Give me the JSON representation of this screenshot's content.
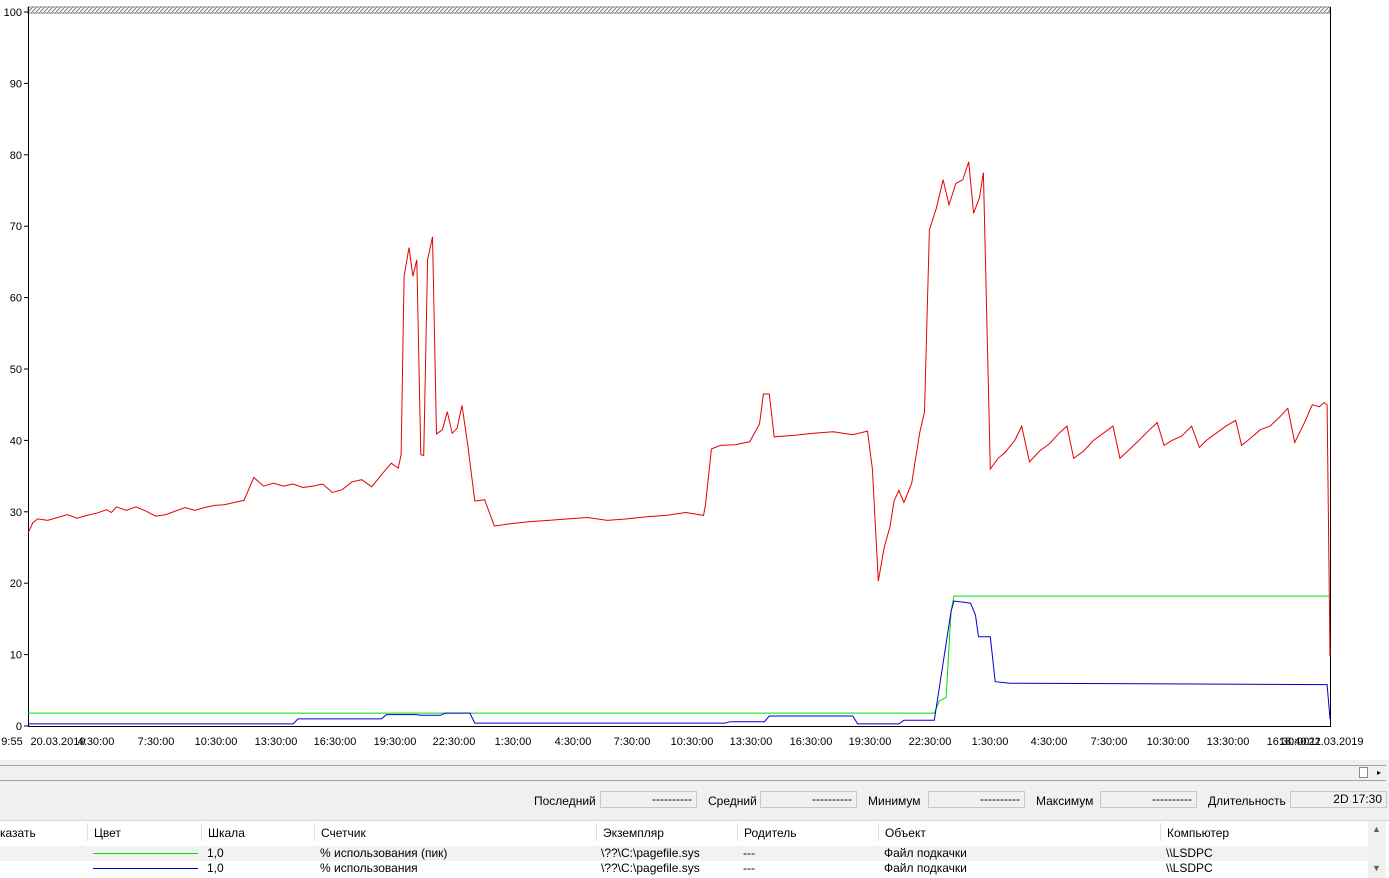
{
  "chart_data": {
    "type": "line",
    "y_ticks": [
      "100",
      "90",
      "80",
      "70",
      "60",
      "50",
      "40",
      "30",
      "20",
      "10",
      "0"
    ],
    "ylim": [
      0,
      100
    ],
    "x_tick_labels": [
      "9:55",
      "20.03.2019",
      "4:30:00",
      "7:30:00",
      "10:30:00",
      "13:30:00",
      "16:30:00",
      "19:30:00",
      "22:30:00",
      "1:30:00",
      "4:30:00",
      "7:30:00",
      "10:30:00",
      "13:30:00",
      "16:30:00",
      "19:30:00",
      "22:30:00",
      "1:30:00",
      "4:30:00",
      "7:30:00",
      "10:30:00",
      "13:30:00",
      "16:30:00",
      "18:40:11",
      "22.03.2019"
    ],
    "grid": false,
    "series": [
      {
        "color": "#e60000",
        "points": [
          [
            0,
            27
          ],
          [
            0.5,
            28.5
          ],
          [
            1,
            29
          ],
          [
            2,
            28.8
          ],
          [
            3,
            29.2
          ],
          [
            4,
            29.6
          ],
          [
            5,
            29.1
          ],
          [
            6,
            29.5
          ],
          [
            7,
            29.8
          ],
          [
            8,
            30.3
          ],
          [
            8.5,
            29.9
          ],
          [
            9,
            30.7
          ],
          [
            10,
            30.2
          ],
          [
            11,
            30.7
          ],
          [
            12,
            30.1
          ],
          [
            13,
            29.4
          ],
          [
            14,
            29.6
          ],
          [
            15,
            30.1
          ],
          [
            16,
            30.6
          ],
          [
            17,
            30.2
          ],
          [
            18,
            30.6
          ],
          [
            19,
            30.9
          ],
          [
            20,
            31.0
          ],
          [
            21,
            31.3
          ],
          [
            22,
            31.6
          ],
          [
            23,
            34.8
          ],
          [
            24,
            33.6
          ],
          [
            25,
            34.0
          ],
          [
            26,
            33.6
          ],
          [
            27,
            33.9
          ],
          [
            28,
            33.4
          ],
          [
            29,
            33.6
          ],
          [
            30,
            33.9
          ],
          [
            31,
            32.7
          ],
          [
            32,
            33.1
          ],
          [
            33,
            34.2
          ],
          [
            34,
            34.5
          ],
          [
            35,
            33.5
          ],
          [
            36,
            35.2
          ],
          [
            37,
            36.8
          ],
          [
            37.7,
            36.1
          ],
          [
            38,
            38
          ],
          [
            38.3,
            63
          ],
          [
            38.8,
            67
          ],
          [
            39.2,
            63
          ],
          [
            39.6,
            65.3
          ],
          [
            40,
            38
          ],
          [
            40.3,
            37.9
          ],
          [
            40.7,
            65.3
          ],
          [
            41.2,
            68.5
          ],
          [
            41.6,
            40.9
          ],
          [
            42.2,
            41.5
          ],
          [
            42.7,
            44.0
          ],
          [
            43.2,
            41.0
          ],
          [
            43.7,
            41.7
          ],
          [
            44.2,
            44.9
          ],
          [
            44.8,
            39.2
          ],
          [
            45.5,
            31.5
          ],
          [
            46.5,
            31.7
          ],
          [
            47.5,
            28.0
          ],
          [
            49,
            28.3
          ],
          [
            51,
            28.6
          ],
          [
            53,
            28.8
          ],
          [
            55,
            29.0
          ],
          [
            57,
            29.2
          ],
          [
            59,
            28.8
          ],
          [
            61,
            29.0
          ],
          [
            63,
            29.3
          ],
          [
            65,
            29.5
          ],
          [
            67,
            29.9
          ],
          [
            68.8,
            29.5
          ],
          [
            69,
            31.0
          ],
          [
            69.6,
            38.8
          ],
          [
            70.5,
            39.3
          ],
          [
            72,
            39.4
          ],
          [
            73.5,
            39.8
          ],
          [
            74.5,
            42.3
          ],
          [
            74.9,
            46.5
          ],
          [
            75.5,
            46.5
          ],
          [
            76,
            40.5
          ],
          [
            78,
            40.7
          ],
          [
            80,
            41.0
          ],
          [
            82,
            41.2
          ],
          [
            84,
            40.8
          ],
          [
            85.5,
            41.3
          ],
          [
            86,
            36.0
          ],
          [
            86.6,
            20.3
          ],
          [
            87.2,
            25.0
          ],
          [
            87.8,
            28.0
          ],
          [
            88.2,
            31.5
          ],
          [
            88.7,
            33.0
          ],
          [
            89.2,
            31.3
          ],
          [
            90,
            34.0
          ],
          [
            90.8,
            41.0
          ],
          [
            91.3,
            44.0
          ],
          [
            91.8,
            69.5
          ],
          [
            92.5,
            72.5
          ],
          [
            93.2,
            76.5
          ],
          [
            93.8,
            73.0
          ],
          [
            94.5,
            76.0
          ],
          [
            95.2,
            76.5
          ],
          [
            95.8,
            79.0
          ],
          [
            96.3,
            71.8
          ],
          [
            96.9,
            74.0
          ],
          [
            97.3,
            77.5
          ],
          [
            98,
            36.0
          ],
          [
            98.8,
            37.5
          ],
          [
            99.5,
            38.3
          ],
          [
            100.5,
            40.0
          ],
          [
            101.2,
            42.0
          ],
          [
            102,
            37.0
          ],
          [
            103,
            38.5
          ],
          [
            104,
            39.5
          ],
          [
            105,
            41.0
          ],
          [
            105.8,
            42.0
          ],
          [
            106.5,
            37.5
          ],
          [
            107.5,
            38.5
          ],
          [
            108.5,
            40.0
          ],
          [
            109.5,
            41.0
          ],
          [
            110.5,
            42.0
          ],
          [
            111.2,
            37.5
          ],
          [
            112,
            38.5
          ],
          [
            113,
            39.8
          ],
          [
            114,
            41.2
          ],
          [
            115,
            42.5
          ],
          [
            115.7,
            39.3
          ],
          [
            116.5,
            40.0
          ],
          [
            117.5,
            40.6
          ],
          [
            118.5,
            42.0
          ],
          [
            119.3,
            39.0
          ],
          [
            120,
            40.0
          ],
          [
            121,
            41.0
          ],
          [
            122,
            42.0
          ],
          [
            123,
            42.8
          ],
          [
            123.6,
            39.3
          ],
          [
            124.5,
            40.3
          ],
          [
            125.5,
            41.5
          ],
          [
            126.5,
            42.0
          ],
          [
            127.5,
            43.3
          ],
          [
            128.3,
            44.5
          ],
          [
            129,
            39.7
          ],
          [
            130,
            42.5
          ],
          [
            130.8,
            45.0
          ],
          [
            131.5,
            44.7
          ],
          [
            132,
            45.3
          ],
          [
            132.3,
            45.0
          ],
          [
            132.6,
            9.8
          ]
        ]
      },
      {
        "color": "#00dd00",
        "points": [
          [
            0,
            1.8
          ],
          [
            45,
            1.8
          ],
          [
            92.3,
            1.8
          ],
          [
            92.8,
            3.5
          ],
          [
            93.5,
            4.0
          ],
          [
            94.0,
            16.0
          ],
          [
            94.3,
            18.2
          ],
          [
            132.6,
            18.2
          ]
        ]
      },
      {
        "color": "#0000cc",
        "points": [
          [
            0,
            0.3
          ],
          [
            27,
            0.3
          ],
          [
            27.5,
            1.0
          ],
          [
            36,
            1.0
          ],
          [
            36.5,
            1.6
          ],
          [
            39.5,
            1.6
          ],
          [
            40,
            1.5
          ],
          [
            42,
            1.5
          ],
          [
            42.5,
            1.8
          ],
          [
            45,
            1.8
          ],
          [
            45.5,
            0.4
          ],
          [
            71,
            0.4
          ],
          [
            71.5,
            0.6
          ],
          [
            75,
            0.6
          ],
          [
            75.5,
            1.4
          ],
          [
            84,
            1.4
          ],
          [
            84.5,
            0.3
          ],
          [
            88.7,
            0.3
          ],
          [
            89.2,
            0.8
          ],
          [
            92.3,
            0.8
          ],
          [
            94.0,
            16.0
          ],
          [
            94.3,
            17.5
          ],
          [
            95.5,
            17.3
          ],
          [
            96.0,
            17.2
          ],
          [
            96.5,
            15.5
          ],
          [
            96.8,
            12.5
          ],
          [
            98,
            12.5
          ],
          [
            98.5,
            6.2
          ],
          [
            100,
            6.0
          ],
          [
            132.3,
            5.8
          ],
          [
            132.6,
            1.0
          ]
        ]
      }
    ]
  },
  "scrollbar": {
    "right_arrow": "▸"
  },
  "stats": {
    "last_label": "Последний",
    "last_value": "----------",
    "avg_label": "Средний",
    "avg_value": "----------",
    "min_label": "Минимум",
    "min_value": "----------",
    "max_label": "Максимум",
    "max_value": "----------",
    "dur_label": "Длительность",
    "dur_value": "2D 17:30"
  },
  "legend": {
    "headers": {
      "show": "казать",
      "color": "Цвет",
      "scale": "Шкала",
      "counter": "Счетчик",
      "instance": "Экземпляр",
      "parent": "Родитель",
      "object": "Объект",
      "computer": "Компьютер"
    },
    "rows": [
      {
        "color": "#00dd00",
        "scale": "1,0",
        "counter": "% использования (пик)",
        "instance": "\\??\\C:\\pagefile.sys",
        "parent": "---",
        "object": "Файл подкачки",
        "computer": "\\\\LSDPC"
      },
      {
        "color": "#0000cc",
        "scale": "1,0",
        "counter": "% использования",
        "instance": "\\??\\C:\\pagefile.sys",
        "parent": "---",
        "object": "Файл подкачки",
        "computer": "\\\\LSDPC"
      }
    ]
  }
}
